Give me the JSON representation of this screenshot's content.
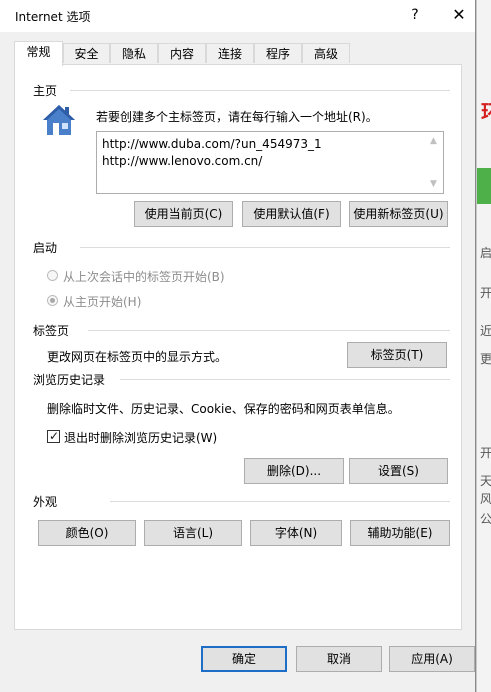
{
  "window": {
    "title": "Internet 选项",
    "help_glyph": "?",
    "close_glyph": "✕"
  },
  "tabs": [
    {
      "label": "常规",
      "active": true
    },
    {
      "label": "安全"
    },
    {
      "label": "隐私"
    },
    {
      "label": "内容"
    },
    {
      "label": "连接"
    },
    {
      "label": "程序"
    },
    {
      "label": "高级"
    }
  ],
  "home": {
    "section_label": "主页",
    "description": "若要创建多个主标签页，请在每行输入一个地址(R)。",
    "urls": [
      "http://www.duba.com/?un_454973_1",
      "http://www.lenovo.com.cn/"
    ],
    "buttons": {
      "use_current": "使用当前页(C)",
      "use_default": "使用默认值(F)",
      "use_new_tab": "使用新标签页(U)"
    }
  },
  "startup": {
    "section_label": "启动",
    "options": [
      {
        "label": "从上次会话中的标签页开始(B)",
        "selected": false
      },
      {
        "label": "从主页开始(H)",
        "selected": true
      }
    ]
  },
  "tabs_section": {
    "section_label": "标签页",
    "description": "更改网页在标签页中的显示方式。",
    "button": "标签页(T)"
  },
  "history": {
    "section_label": "浏览历史记录",
    "description": "删除临时文件、历史记录、Cookie、保存的密码和网页表单信息。",
    "checkbox_label": "退出时删除浏览历史记录(W)",
    "checkbox_checked": true,
    "delete_button": "删除(D)...",
    "settings_button": "设置(S)"
  },
  "appearance": {
    "section_label": "外观",
    "buttons": {
      "colors": "颜色(O)",
      "languages": "语言(L)",
      "fonts": "字体(N)",
      "accessibility": "辅助功能(E)"
    }
  },
  "footer": {
    "ok": "确定",
    "cancel": "取消",
    "apply": "应用(A)"
  },
  "background": {
    "red_glyph": "环",
    "glyphs": [
      "启",
      "开",
      "近",
      "更",
      "开",
      "天",
      "风",
      "公"
    ]
  },
  "colors": {
    "dialog_bg": "#f0f0f0",
    "panel_bg": "#ffffff",
    "default_button_border": "#1e6ec8",
    "background_green": "#4db049",
    "background_red": "#d42020"
  }
}
